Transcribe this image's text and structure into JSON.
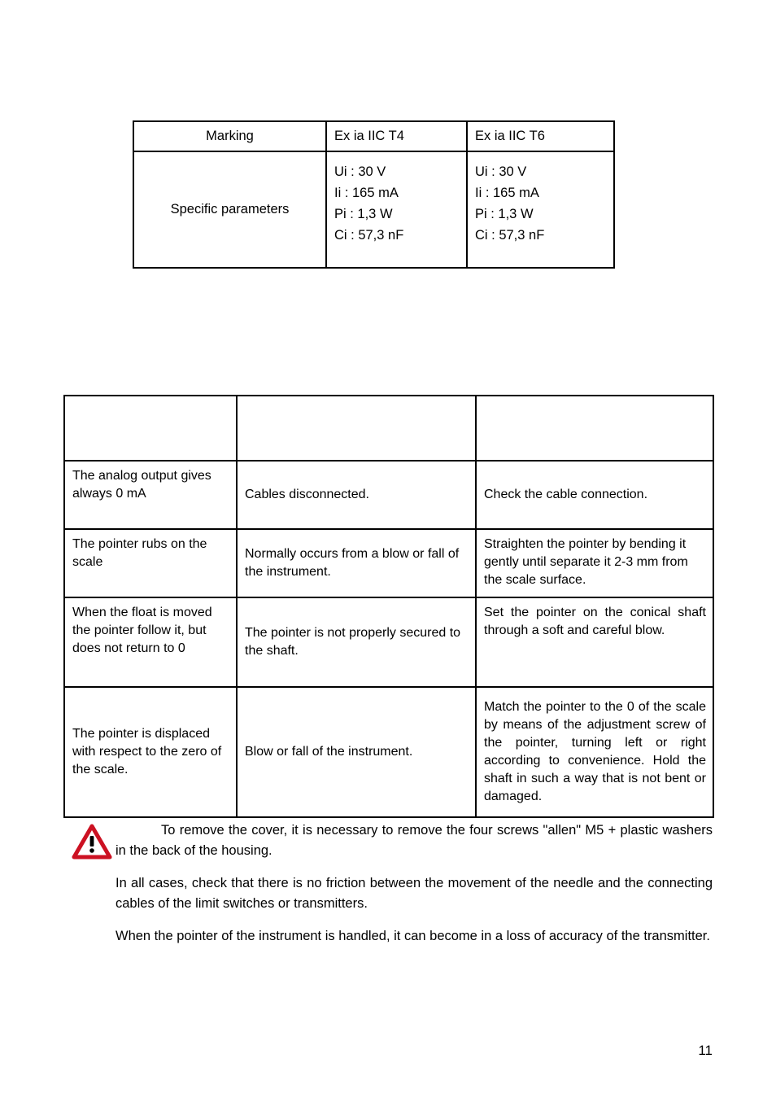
{
  "marking_table": {
    "header": {
      "label": "Marking",
      "col_t4": "Ex ia IIC T4",
      "col_t6": "Ex ia IIC T6"
    },
    "body": {
      "label": "Specific parameters",
      "t4_params": [
        "Ui : 30 V",
        "Ii : 165 mA",
        "Pi : 1,3 W",
        "Ci : 57,3 nF"
      ],
      "t6_params": [
        "Ui : 30 V",
        "Ii : 165 mA",
        "Pi : 1,3 W",
        "Ci : 57,3 nF"
      ]
    }
  },
  "trouble_table": {
    "headers": [
      "",
      "",
      ""
    ],
    "rows": [
      {
        "symptom": "The analog output gives always 0 mA",
        "cause": "Cables disconnected.",
        "solution": "Check the cable connection."
      },
      {
        "symptom": "The pointer rubs on the scale",
        "cause": "Normally occurs from a blow or fall of the instrument.",
        "solution": "Straighten the pointer by bending it gently until separate it 2-3 mm from the scale surface."
      },
      {
        "symptom": "When the float is moved the pointer follow it, but does not return to 0",
        "cause": "The pointer is not properly secured to the shaft.",
        "solution": "Set the pointer on the conical shaft through a soft and careful blow."
      },
      {
        "symptom": "The pointer is displaced with respect to the zero of the scale.",
        "cause": "Blow or fall of the instrument.",
        "solution": "Match the pointer to the 0 of the scale by means of the adjustment screw of the pointer, turning left or right according to convenience. Hold the shaft in such a way that is not bent or damaged."
      }
    ]
  },
  "notes": {
    "warning_icon": "warning-triangle-icon",
    "warning_colors": {
      "triangle": "#cc1122",
      "mark": "#000000",
      "fill": "#ffffff"
    },
    "paragraphs": [
      "To remove the cover, it is necessary to remove the four screws \"allen\" M5 + plastic washers in the back of the housing.",
      "In all cases, check that there is no friction between the movement of the needle and the connecting cables of the limit switches or transmitters.",
      "When the pointer of the instrument is handled, it can become in a loss of accuracy of the transmitter."
    ]
  },
  "footer": {
    "page_number": "11"
  }
}
